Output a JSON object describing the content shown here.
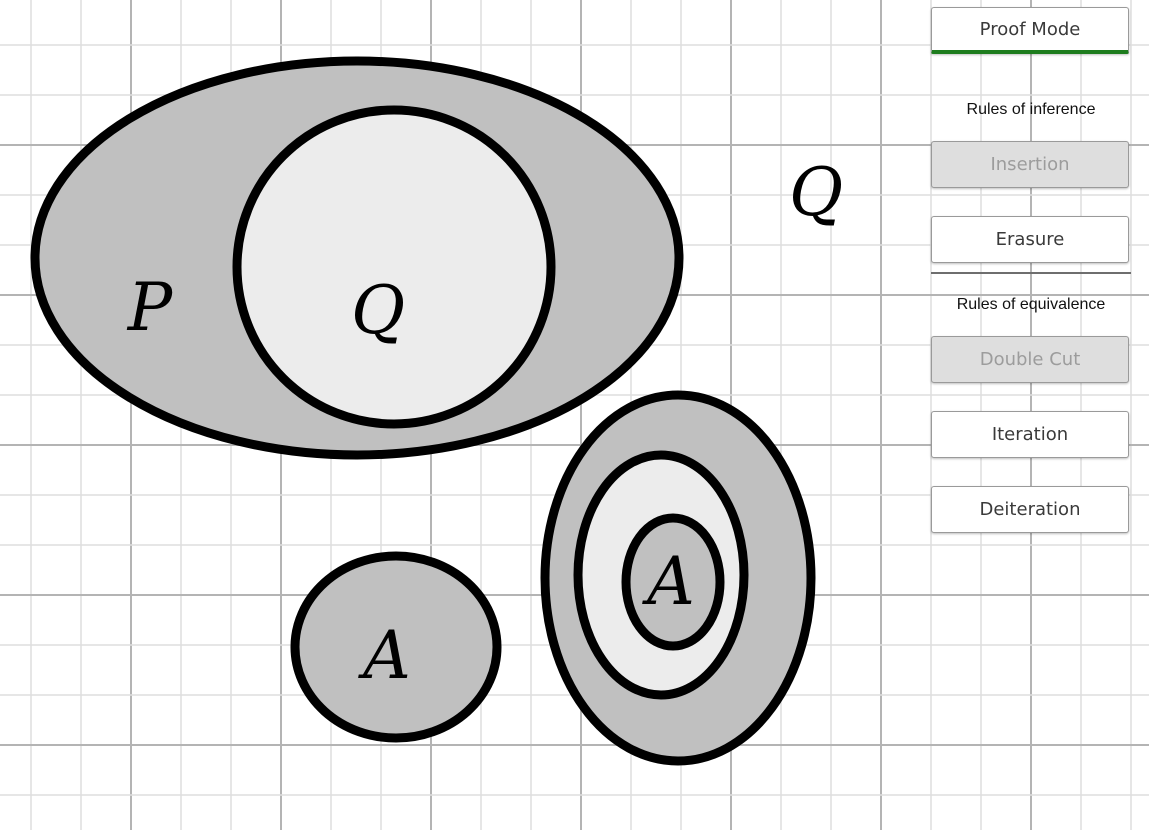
{
  "diagram": {
    "labels": {
      "outer_left": "P",
      "inner_left": "Q",
      "standalone": "Q",
      "small_circle": "A",
      "nested_innermost": "A"
    }
  },
  "panel": {
    "mode_button": "Proof Mode",
    "inference_header": "Rules of inference",
    "insertion": "Insertion",
    "erasure": "Erasure",
    "equivalence_header": "Rules of equivalence",
    "double_cut": "Double Cut",
    "iteration": "Iteration",
    "deiteration": "Deiteration"
  },
  "colors": {
    "odd_cut_fill": "#c0c0c0",
    "even_cut_fill": "#ececec",
    "active_mode_accent": "#1e7d1e",
    "disabled_button": "#dedede"
  }
}
